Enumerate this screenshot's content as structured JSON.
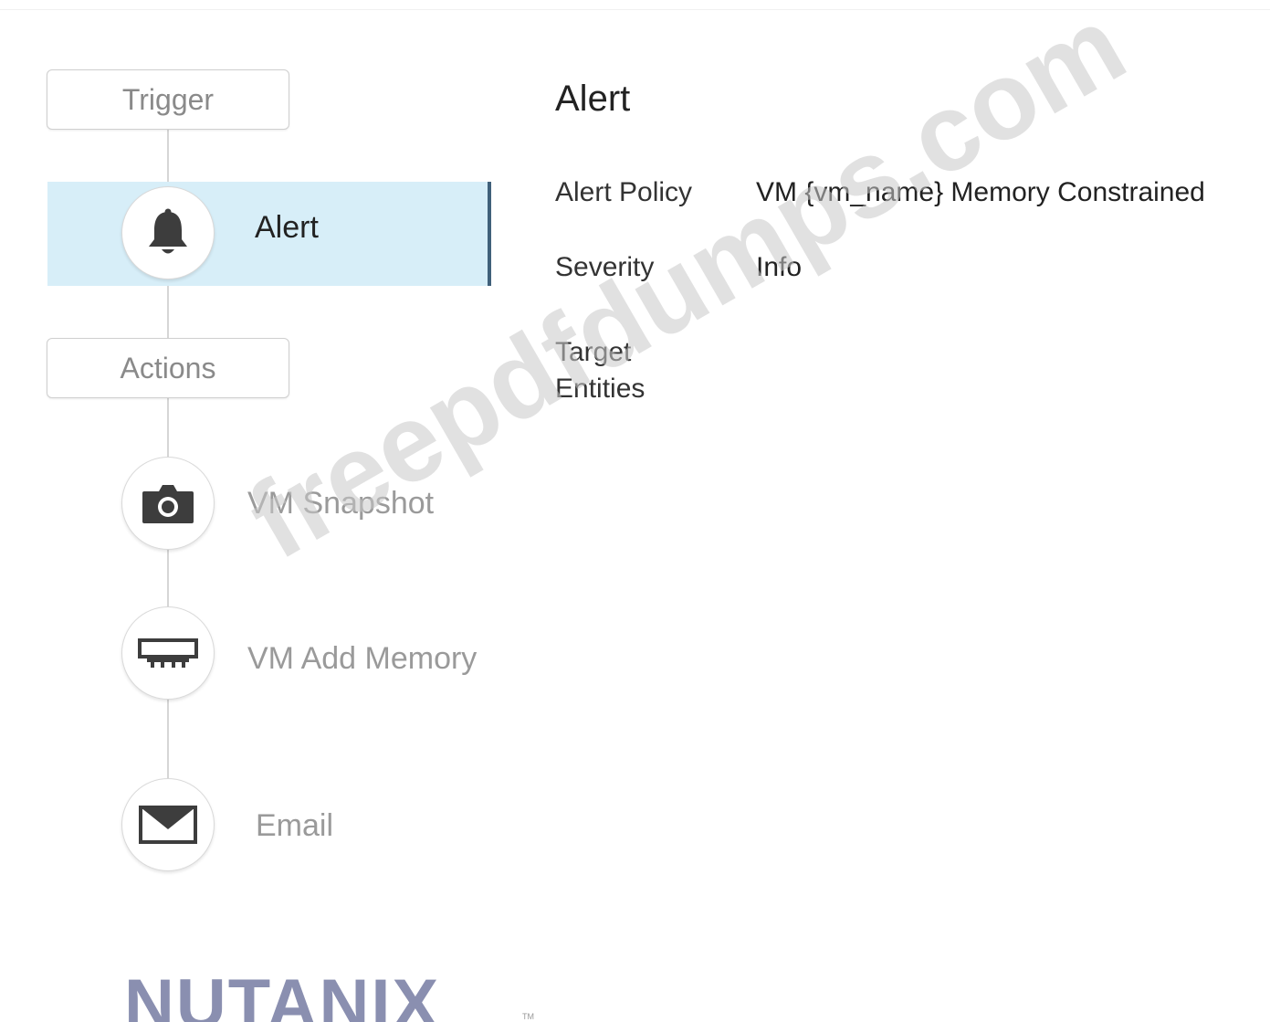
{
  "flow": {
    "trigger_label": "Trigger",
    "actions_label": "Actions",
    "trigger_item": {
      "label": "Alert",
      "icon": "bell-icon"
    },
    "action_items": [
      {
        "label": "VM Snapshot",
        "icon": "camera-icon"
      },
      {
        "label": "VM Add Memory",
        "icon": "memory-icon"
      },
      {
        "label": "Email",
        "icon": "envelope-icon"
      }
    ]
  },
  "details": {
    "title": "Alert",
    "fields": [
      {
        "label": "Alert Policy",
        "value": "VM {vm_name} Memory Constrained"
      },
      {
        "label": "Severity",
        "value": "Info"
      },
      {
        "label": "Target Entities",
        "value": ""
      }
    ]
  },
  "branding": {
    "logo": "NUTANIX",
    "tm": "TM",
    "watermark": "freepdfdumps.com"
  },
  "colors": {
    "selected_bg": "#d7eef8",
    "selected_bar": "#40607a",
    "logo": "#8a8fb0"
  }
}
